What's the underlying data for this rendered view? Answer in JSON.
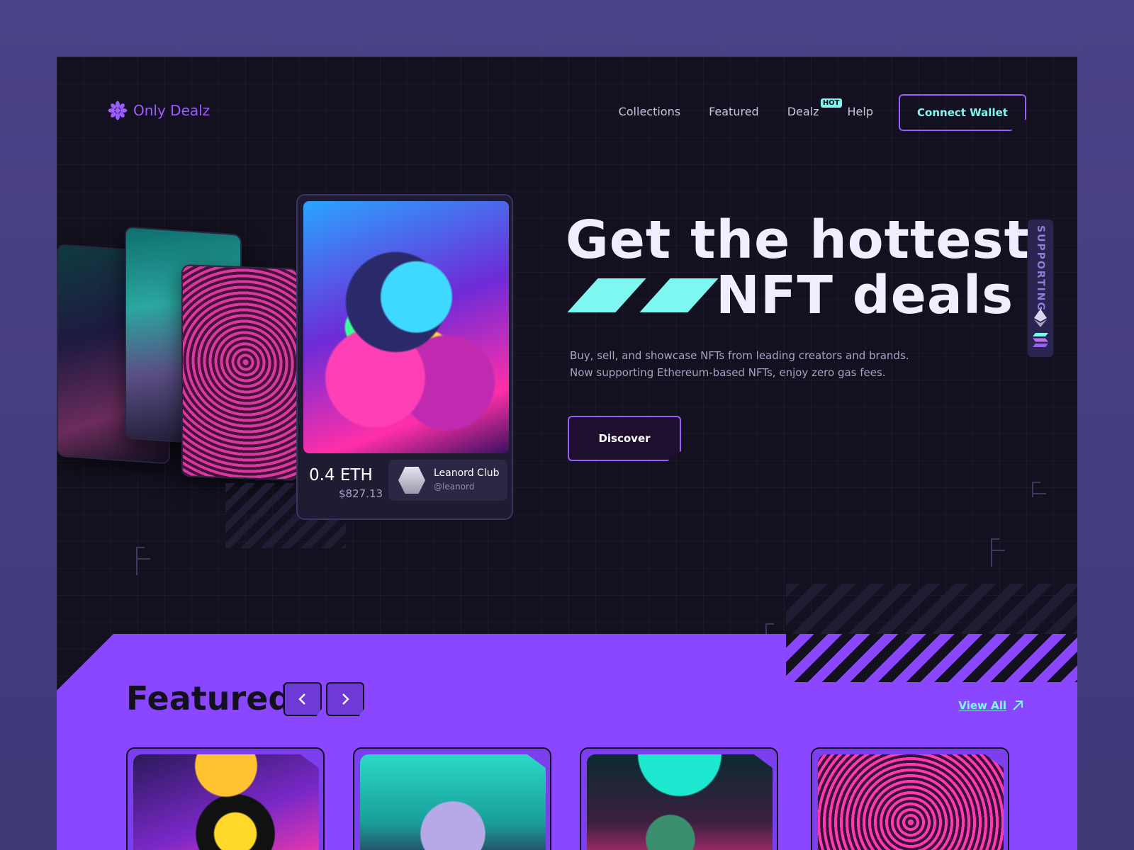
{
  "brand": {
    "name": "Only Dealz"
  },
  "nav": {
    "items": [
      {
        "label": "Collections"
      },
      {
        "label": "Featured"
      },
      {
        "label": "Dealz",
        "badge": "HOT"
      },
      {
        "label": "Help"
      }
    ],
    "connect_label": "Connect Wallet"
  },
  "hero": {
    "title_line1": "Get the hottest",
    "title_line2": "NFT deals",
    "subtitle_line1": "Buy, sell, and showcase NFTs from leading creators and brands.",
    "subtitle_line2": "Now supporting Ethereum-based NFTs, enjoy zero gas fees.",
    "discover_label": "Discover",
    "card": {
      "price_eth": "0.4 ETH",
      "price_usd": "$827.13",
      "owner_name": "Leanord Club",
      "owner_handle": "@leanord"
    }
  },
  "supporting": {
    "label": "SUPPORTING",
    "chains": [
      "ethereum-icon",
      "solana-icon"
    ]
  },
  "featured": {
    "title": "Featured",
    "view_all_label": "View All",
    "prev_icon": "chevron-left-icon",
    "next_icon": "chevron-right-icon"
  },
  "colors": {
    "accent_purple": "#9b5cff",
    "accent_cyan": "#7ef7f0",
    "band_purple": "#8b46ff",
    "background": "#13111f"
  }
}
